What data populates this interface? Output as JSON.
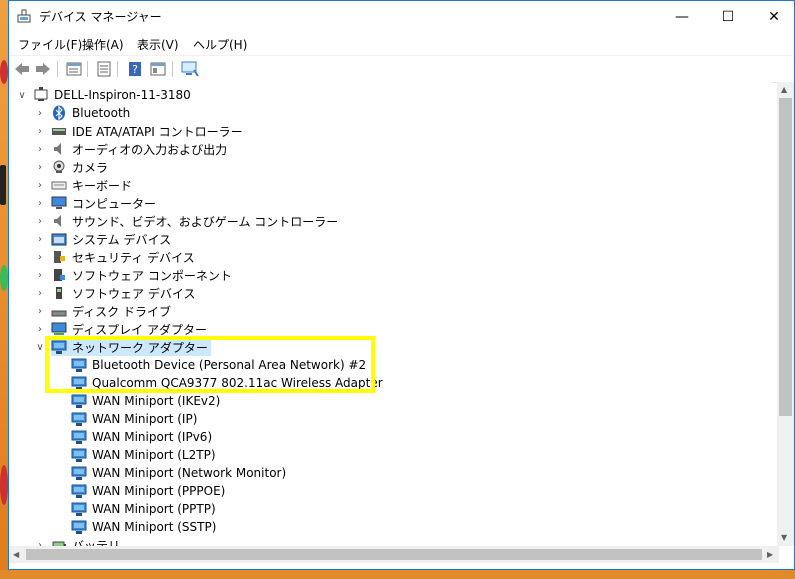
{
  "window": {
    "title": "デバイス マネージャー",
    "min_glyph": "—",
    "max_glyph": "☐",
    "close_glyph": "✕"
  },
  "menu": [
    "ファイル(F)",
    "操作(A)",
    "表示(V)",
    "ヘルプ(H)"
  ],
  "toolbar": [
    "back-icon",
    "forward-icon",
    "properties-icon",
    "update-icon",
    "help-icon",
    "view-icon",
    "scan-hardware-icon"
  ],
  "tree": {
    "root": "DELL-Inspiron-11-3180",
    "categories": [
      {
        "label": "Bluetooth",
        "icon": "bluetooth-icon"
      },
      {
        "label": "IDE ATA/ATAPI コントローラー",
        "icon": "ide-icon"
      },
      {
        "label": "オーディオの入力および出力",
        "icon": "speaker-icon"
      },
      {
        "label": "カメラ",
        "icon": "camera-icon"
      },
      {
        "label": "キーボード",
        "icon": "keyboard-icon"
      },
      {
        "label": "コンピューター",
        "icon": "computer-icon"
      },
      {
        "label": "サウンド、ビデオ、およびゲーム コントローラー",
        "icon": "sound-icon"
      },
      {
        "label": "システム デバイス",
        "icon": "system-folder-icon"
      },
      {
        "label": "セキュリティ デバイス",
        "icon": "security-icon"
      },
      {
        "label": "ソフトウェア コンポーネント",
        "icon": "software-component-icon"
      },
      {
        "label": "ソフトウェア デバイス",
        "icon": "software-device-icon"
      },
      {
        "label": "ディスク ドライブ",
        "icon": "disk-drive-icon"
      },
      {
        "label": "ディスプレイ アダプター",
        "icon": "display-adapter-icon"
      }
    ],
    "network": {
      "label": "ネットワーク アダプター",
      "children": [
        "Bluetooth Device (Personal Area Network) #2",
        "Qualcomm QCA9377 802.11ac Wireless Adapter",
        "WAN Miniport (IKEv2)",
        "WAN Miniport (IP)",
        "WAN Miniport (IPv6)",
        "WAN Miniport (L2TP)",
        "WAN Miniport (Network Monitor)",
        "WAN Miniport (PPPOE)",
        "WAN Miniport (PPTP)",
        "WAN Miniport (SSTP)"
      ]
    },
    "next_category": "バッテリ"
  },
  "colors": {
    "accent": "#1979ca",
    "highlight": "#ffff00",
    "selection": "#cce8ff",
    "desktop": "#e08a2c"
  }
}
